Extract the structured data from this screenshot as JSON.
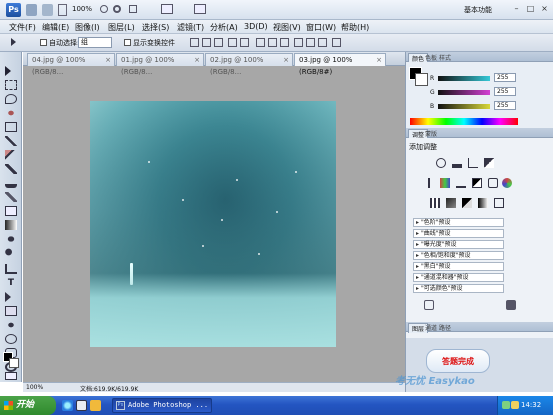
{
  "app": {
    "logo": "Ps",
    "zoom": "100%",
    "workspace": "基本功能",
    "win_controls": [
      "–",
      "□",
      "×"
    ]
  },
  "menu": [
    "文件(F)",
    "编辑(E)",
    "图像(I)",
    "图层(L)",
    "选择(S)",
    "滤镜(T)",
    "分析(A)",
    "3D(D)",
    "视图(V)",
    "窗口(W)",
    "帮助(H)"
  ],
  "options": {
    "auto_select_label": "自动选择:",
    "auto_select_value": "组",
    "show_transform_label": "显示变换控件"
  },
  "tabs": [
    {
      "label": "04.jpg @ 100%(RGB/8...",
      "active": false
    },
    {
      "label": "01.jpg @ 100%(RGB/8...",
      "active": false
    },
    {
      "label": "02.jpg @ 100%(RGB/8...",
      "active": false
    },
    {
      "label": "03.jpg @ 100%(RGB/8#)",
      "active": true
    }
  ],
  "status": {
    "zoom": "100%",
    "doc": "文档:619.9K/619.9K"
  },
  "color_panel": {
    "tabs": [
      "颜色",
      "色板",
      "样式"
    ],
    "labels": [
      "R",
      "G",
      "B"
    ],
    "values": [
      "255",
      "255",
      "255"
    ],
    "slider_colors": [
      "#34c9d8",
      "#d43fd4",
      "#d8d83a"
    ]
  },
  "adjust_panel": {
    "tabs": [
      "调整",
      "蒙版"
    ],
    "title": "添加调整",
    "presets": [
      "\"色阶\"预设",
      "\"曲线\"预设",
      "\"曝光度\"预设",
      "\"色相/饱和度\"预设",
      "\"黑白\"预设",
      "\"通道混和器\"预设",
      "\"可选颜色\"预设"
    ]
  },
  "layers_panel": {
    "tabs": [
      "图层",
      "通道",
      "路径"
    ]
  },
  "overlay": {
    "badge": "答题完成",
    "watermark": "考无忧 Easykao"
  },
  "taskbar": {
    "start": "开始",
    "task": "Adobe Photoshop ...",
    "clock": "14:32"
  }
}
